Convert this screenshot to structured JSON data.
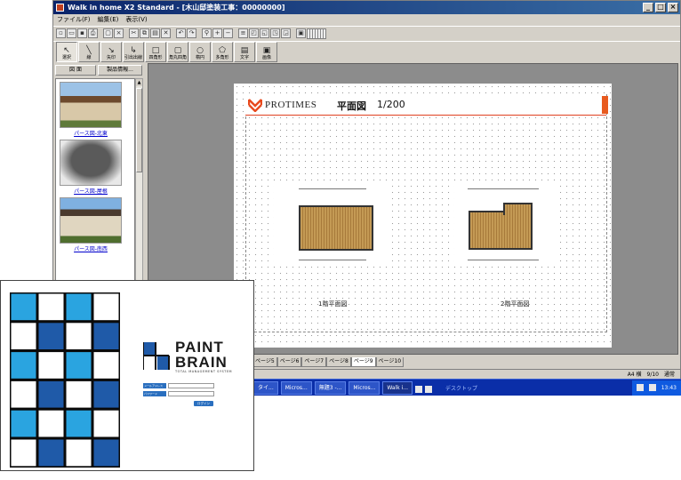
{
  "window": {
    "title": "Walk in home X2 Standard - [木山邸塗装工事：00000000]",
    "controls": [
      "_",
      "□",
      "×"
    ]
  },
  "menu": [
    "ファイル(F)",
    "編集(E)",
    "表示(V)"
  ],
  "toolbar_tools": [
    {
      "label": "選択",
      "icon": "cursor-icon"
    },
    {
      "label": "線",
      "icon": "line-icon"
    },
    {
      "label": "矢印",
      "icon": "arrow-icon"
    },
    {
      "label": "引出出線",
      "icon": "leader-line-icon"
    },
    {
      "label": "四角形",
      "icon": "rectangle-icon"
    },
    {
      "label": "角丸四角",
      "icon": "rounded-rect-icon"
    },
    {
      "label": "楕円",
      "icon": "ellipse-icon"
    },
    {
      "label": "多角形",
      "icon": "polygon-icon"
    },
    {
      "label": "文字",
      "icon": "text-icon"
    },
    {
      "label": "画像",
      "icon": "image-icon"
    }
  ],
  "left_panel": {
    "tabs": [
      "図 面",
      "製品情報..."
    ],
    "items": [
      {
        "label": "パース図-北東"
      },
      {
        "label": "パース図-屋根"
      },
      {
        "label": "パース図-南西"
      }
    ]
  },
  "sheet": {
    "brand": "PROTIMES",
    "title": "平面図",
    "scale": "1/200",
    "plans": [
      {
        "label": "1階平面図"
      },
      {
        "label": "2階平面図"
      }
    ]
  },
  "page_tabs": [
    "ページ5",
    "ページ6",
    "ページ7",
    "ページ8",
    "ページ9",
    "ページ10"
  ],
  "status": {
    "text": "A4 横　9/10　通常"
  },
  "taskbar": {
    "tasks": [
      "タイ...",
      "Micros...",
      "無題3 -...",
      "Micros...",
      "Walk i..."
    ],
    "desktop": "デスクトップ",
    "clock": "13:43"
  },
  "login": {
    "brand_line1": "PAINT",
    "brand_line2": "BRAIN",
    "brand_sub": "TOTAL MANAGEMENT SYSTEM",
    "mail_label": "メールアドレス",
    "password_label": "パスワード",
    "button": "ログイン",
    "checker_colors": {
      "dark": "#1f5aa8",
      "light": "#2aa4e0",
      "white": "#ffffff",
      "border": "#0a0a0a"
    }
  }
}
